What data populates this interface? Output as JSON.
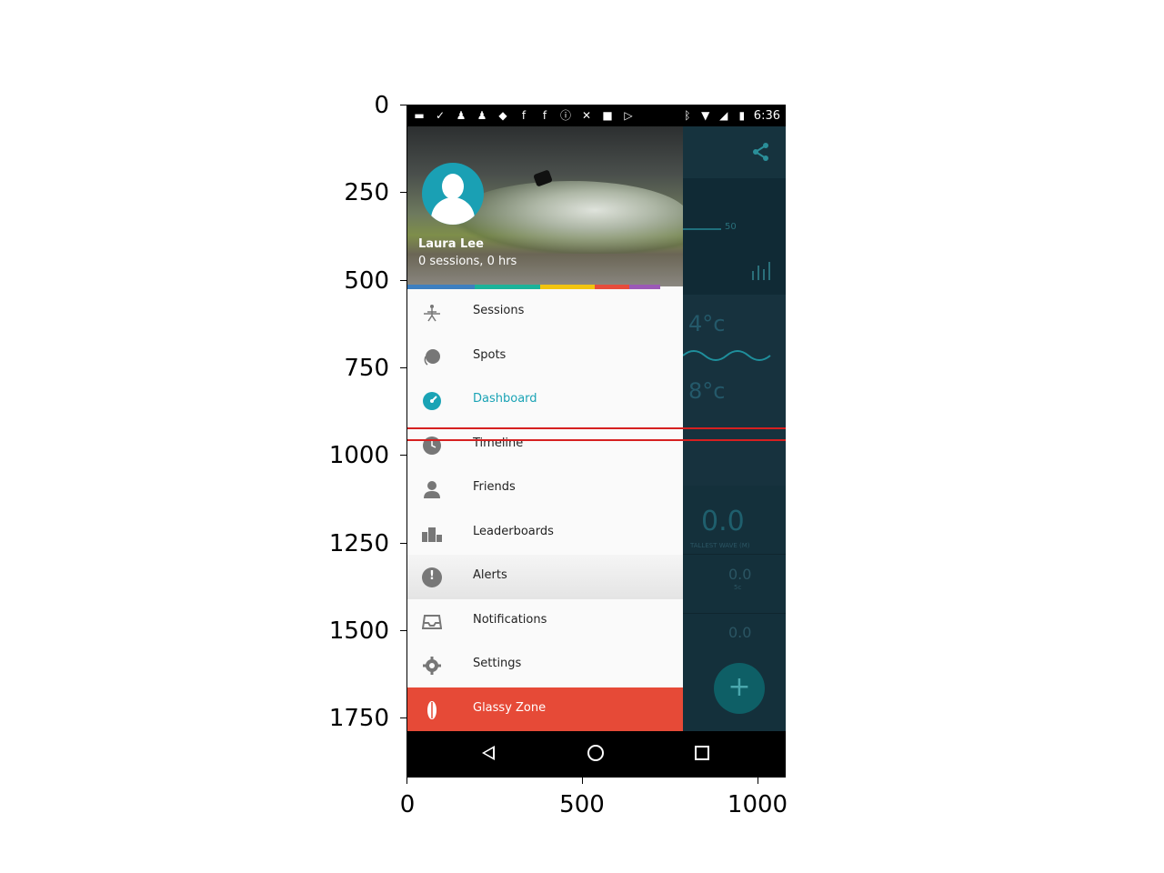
{
  "axes": {
    "y_ticks": [
      "0",
      "250",
      "500",
      "750",
      "1000",
      "1250",
      "1500",
      "1750"
    ],
    "x_ticks": [
      "0",
      "500",
      "1000"
    ]
  },
  "status_bar": {
    "time": "6:36"
  },
  "drawer": {
    "user_name": "Laura Lee",
    "user_stats": "0 sessions, 0 hrs",
    "strip_colors": [
      "#3d7fc0",
      "#1bb39a",
      "#f1c40f",
      "#e74c3c",
      "#9b59b6"
    ],
    "items": [
      {
        "label": "Sessions",
        "icon": "surfer-icon"
      },
      {
        "label": "Spots",
        "icon": "spot-pin-icon"
      },
      {
        "label": "Dashboard",
        "icon": "dashboard-icon",
        "active": true
      },
      {
        "label": "Timeline",
        "icon": "clock-icon"
      },
      {
        "label": "Friends",
        "icon": "person-icon"
      },
      {
        "label": "Leaderboards",
        "icon": "leaderboard-icon"
      },
      {
        "label": "Alerts",
        "icon": "alert-icon",
        "pressed": true
      },
      {
        "label": "Notifications",
        "icon": "inbox-icon"
      },
      {
        "label": "Settings",
        "icon": "gear-icon"
      },
      {
        "label": "Glassy Zone",
        "icon": "surfboard-icon",
        "highlight_color": "#e64a37"
      }
    ]
  },
  "background_app": {
    "wave_height_label": "50",
    "temp_air": "4°c",
    "temp_water": "8°c",
    "tallest_wave_value": "0.0",
    "tallest_wave_label": "TALLEST WAVE (M)",
    "stat_1": "0.0",
    "stat_1_unit": "5c",
    "stat_2": "0.0"
  },
  "colors": {
    "accent": "#1aa3b5",
    "glassy": "#e64a37",
    "overlay_line": "#d62020"
  }
}
